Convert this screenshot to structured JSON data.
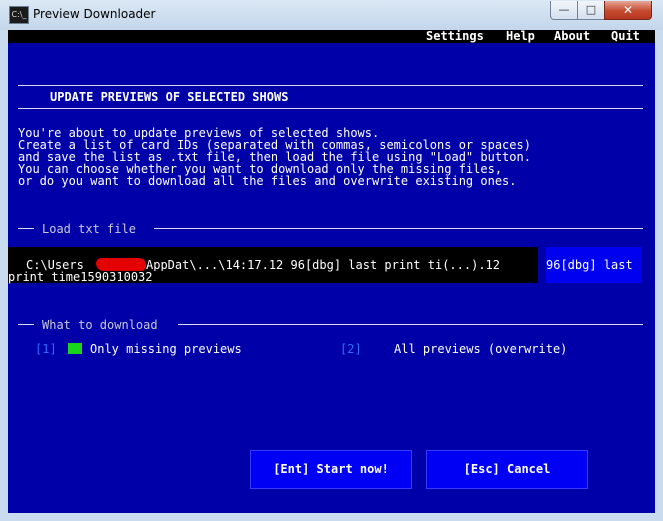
{
  "window": {
    "title": "Preview Downloader",
    "icon_label": "C:\\_"
  },
  "menu": [
    "Settings",
    "Help",
    "About",
    "Quit"
  ],
  "heading": "UPDATE PREVIEWS OF SELECTED SHOWS",
  "intro": [
    "You're about to update previews of selected shows.",
    "Create a list of card IDs (separated with commas, semicolons or spaces)",
    "and save the list as .txt file, then load the file using \"Load\" button.",
    "You can choose whether you want to download only the missing files,",
    "or do you want to download all the files and overwrite existing ones."
  ],
  "load_section": {
    "label": "Load txt file",
    "path_line1_a": "C:\\Users",
    "path_line1_b": "AppDat\\...\\14:17.12 96[dbg] last print ti(...).12",
    "load_button_overflow": "96[dbg] last",
    "path_line2": "print time1590310032"
  },
  "download_section": {
    "label": "What to download",
    "option1_key": "[1]",
    "option1_label": "Only missing previews",
    "option2_key": "[2]",
    "option2_label": "All previews (overwrite)"
  },
  "buttons": {
    "start": "[Ent] Start now!",
    "cancel": "[Esc] Cancel"
  }
}
